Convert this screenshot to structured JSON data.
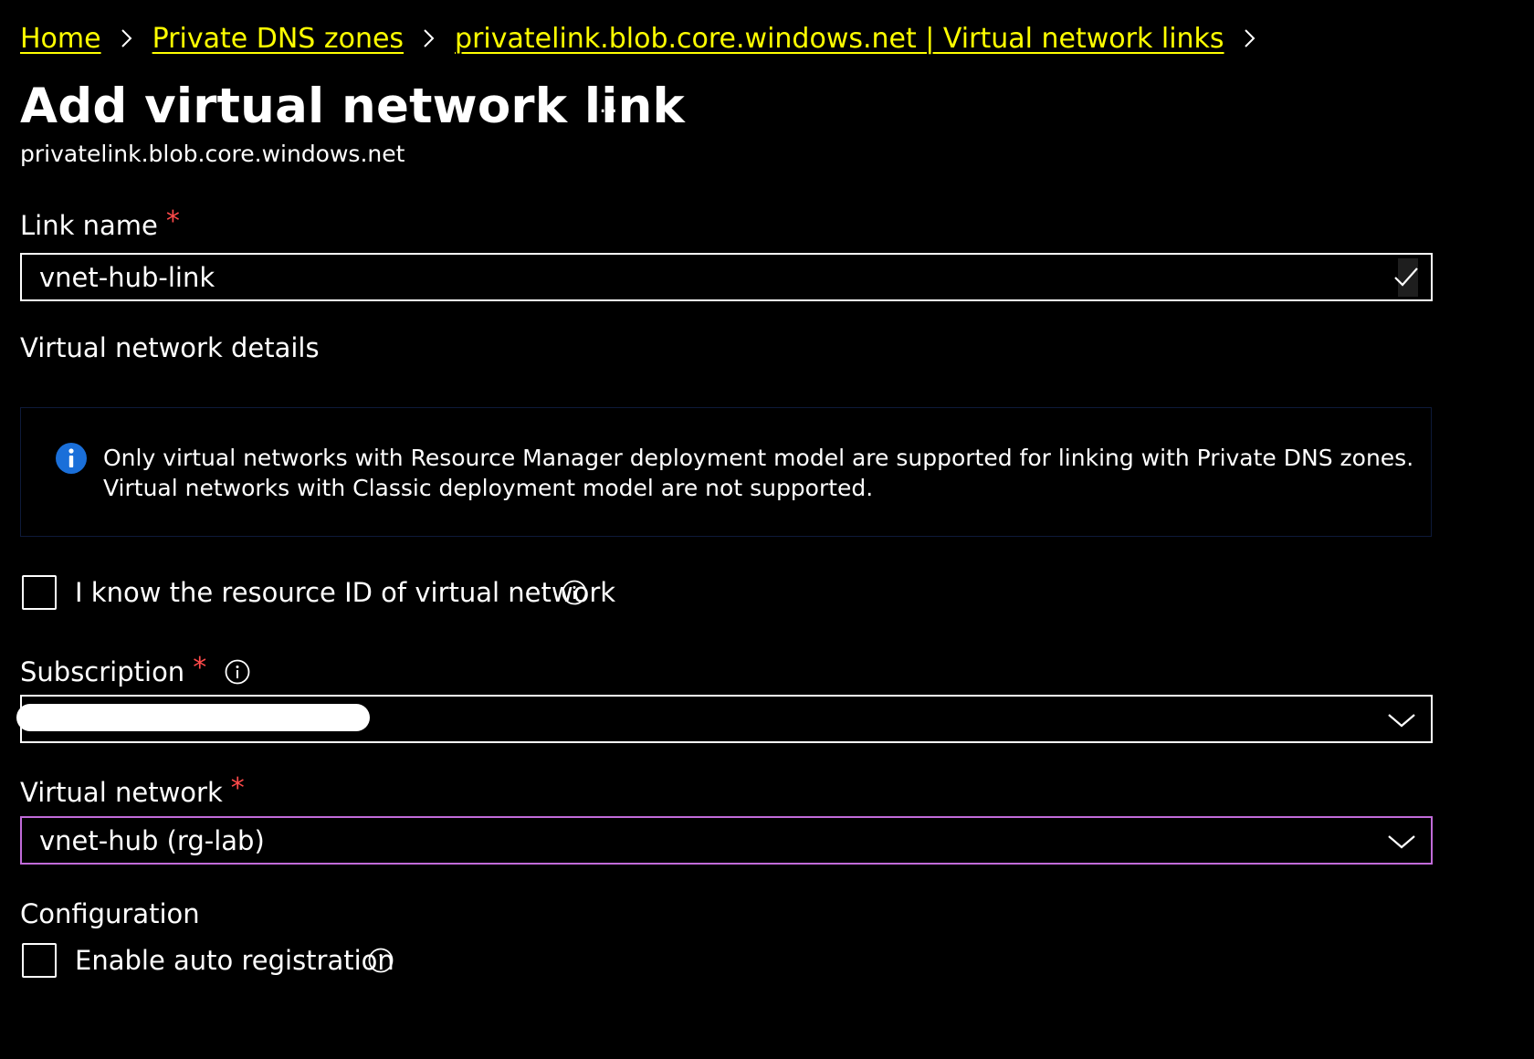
{
  "breadcrumb": {
    "items": [
      {
        "label": "Home"
      },
      {
        "label": "Private DNS zones"
      },
      {
        "label": "privatelink.blob.core.windows.net | Virtual network links"
      }
    ]
  },
  "page": {
    "title": "Add virtual network link",
    "more_label": "...",
    "subtitle": "privatelink.blob.core.windows.net"
  },
  "link_name": {
    "label": "Link name",
    "required_marker": "*",
    "value": "vnet-hub-link"
  },
  "vnet_details": {
    "heading": "Virtual network details",
    "info_line1": "Only virtual networks with Resource Manager deployment model are supported for linking with Private DNS zones.",
    "info_line2": "Virtual networks with Classic deployment model are not supported."
  },
  "resource_id_checkbox": {
    "label": "I know the resource ID of virtual network",
    "checked": false
  },
  "subscription": {
    "label": "Subscription",
    "required_marker": "*",
    "value": ""
  },
  "virtual_network": {
    "label": "Virtual network",
    "required_marker": "*",
    "value": "vnet-hub (rg-lab)"
  },
  "configuration": {
    "heading": "Configuration",
    "auto_registration_label": "Enable auto registration",
    "auto_registration_checked": false
  },
  "colors": {
    "link": "#ffff00",
    "required": "#ff4a4a",
    "focus_border": "#c16bd9",
    "info_icon": "#1a6fd9",
    "background": "#000000"
  },
  "icons": {
    "breadcrumb_separator": "chevron-right-icon",
    "link_valid": "checkmark-icon",
    "info_banner": "info-filled-icon",
    "tooltip": "info-outline-icon",
    "dropdown": "chevron-down-icon"
  }
}
